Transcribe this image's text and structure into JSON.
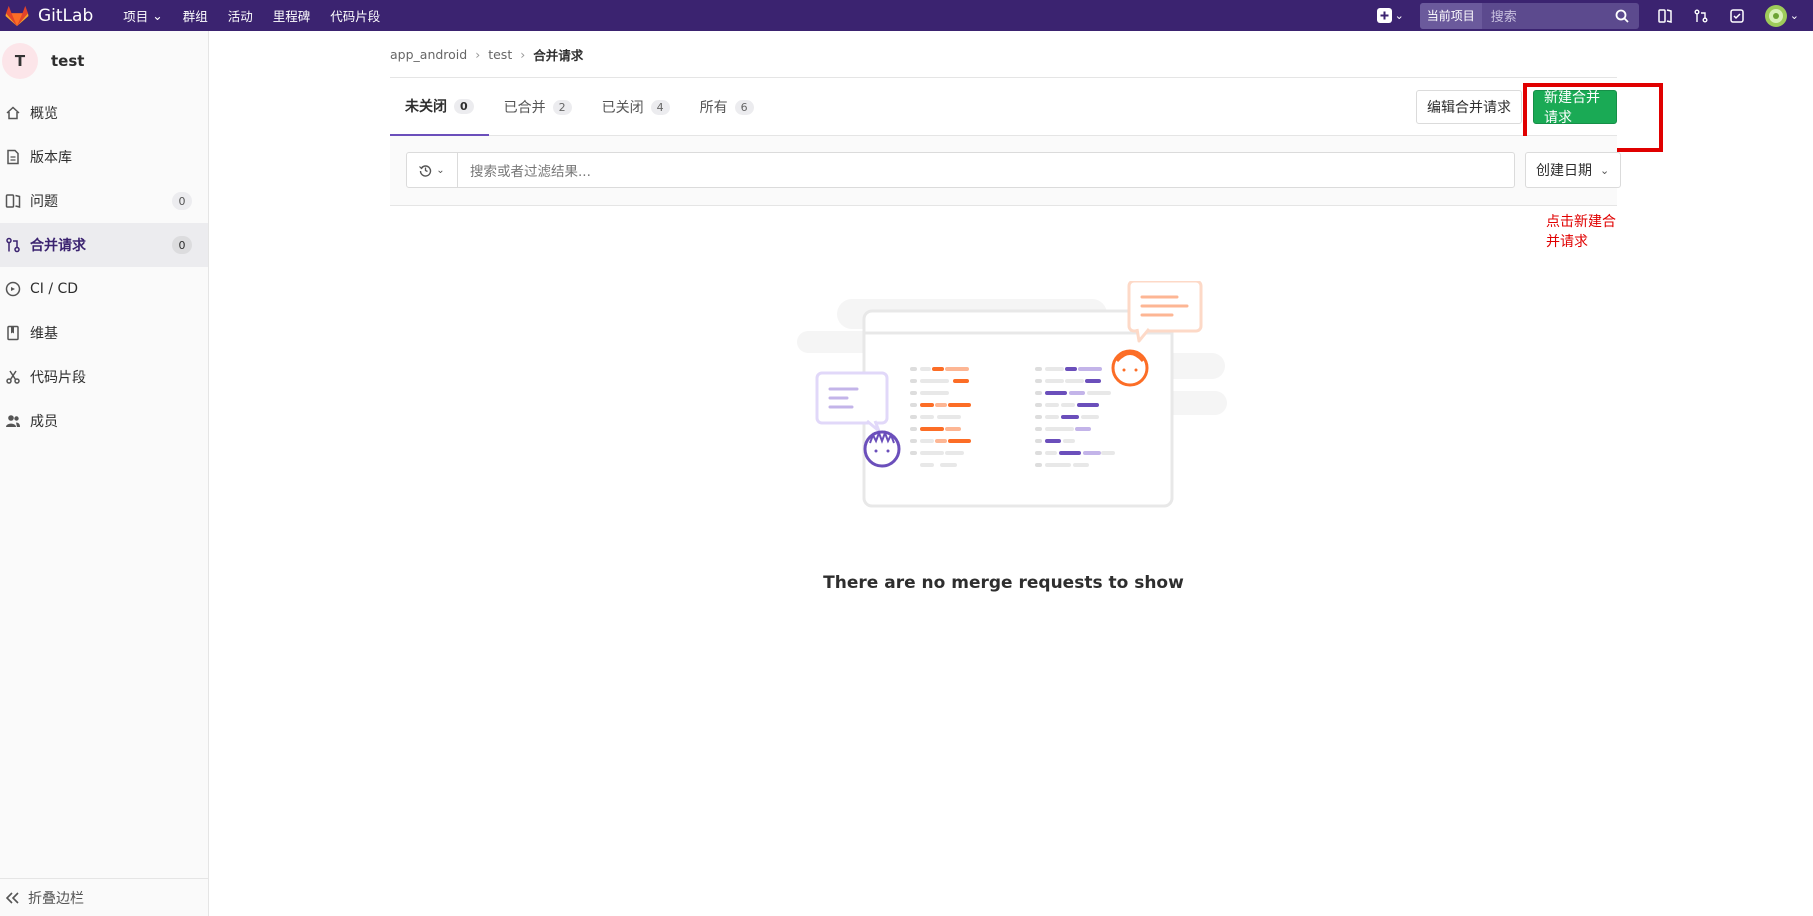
{
  "navbar": {
    "brand": "GitLab",
    "menu": [
      "项目",
      "群组",
      "活动",
      "里程碑",
      "代码片段"
    ],
    "scope": "当前项目",
    "search_placeholder": "搜索"
  },
  "sidebar": {
    "project_initial": "T",
    "project_name": "test",
    "items": [
      {
        "label": "概览",
        "icon": "home-icon"
      },
      {
        "label": "版本库",
        "icon": "doc-icon"
      },
      {
        "label": "问题",
        "icon": "issues-icon",
        "count": "0"
      },
      {
        "label": "合并请求",
        "icon": "merge-request-icon",
        "count": "0"
      },
      {
        "label": "CI / CD",
        "icon": "rocket-icon"
      },
      {
        "label": "维基",
        "icon": "book-icon"
      },
      {
        "label": "代码片段",
        "icon": "scissors-icon"
      },
      {
        "label": "成员",
        "icon": "users-icon"
      }
    ],
    "collapse_label": "折叠边栏"
  },
  "breadcrumb": [
    "app_android",
    "test",
    "合并请求"
  ],
  "tabs": [
    {
      "label": "未关闭",
      "count": "0"
    },
    {
      "label": "已合并",
      "count": "2"
    },
    {
      "label": "已关闭",
      "count": "4"
    },
    {
      "label": "所有",
      "count": "6"
    }
  ],
  "buttons": {
    "edit": "编辑合并请求",
    "new": "新建合并请求"
  },
  "filter": {
    "placeholder": "搜索或者过滤结果...",
    "sort": "创建日期"
  },
  "annotation": "点击新建合并请求",
  "empty_state": "There are no merge requests to show",
  "colors": {
    "navbar": "#3b2370",
    "new_button": "#1aaa55",
    "annotation": "#e00000",
    "tab_active": "#6b4fbb"
  }
}
